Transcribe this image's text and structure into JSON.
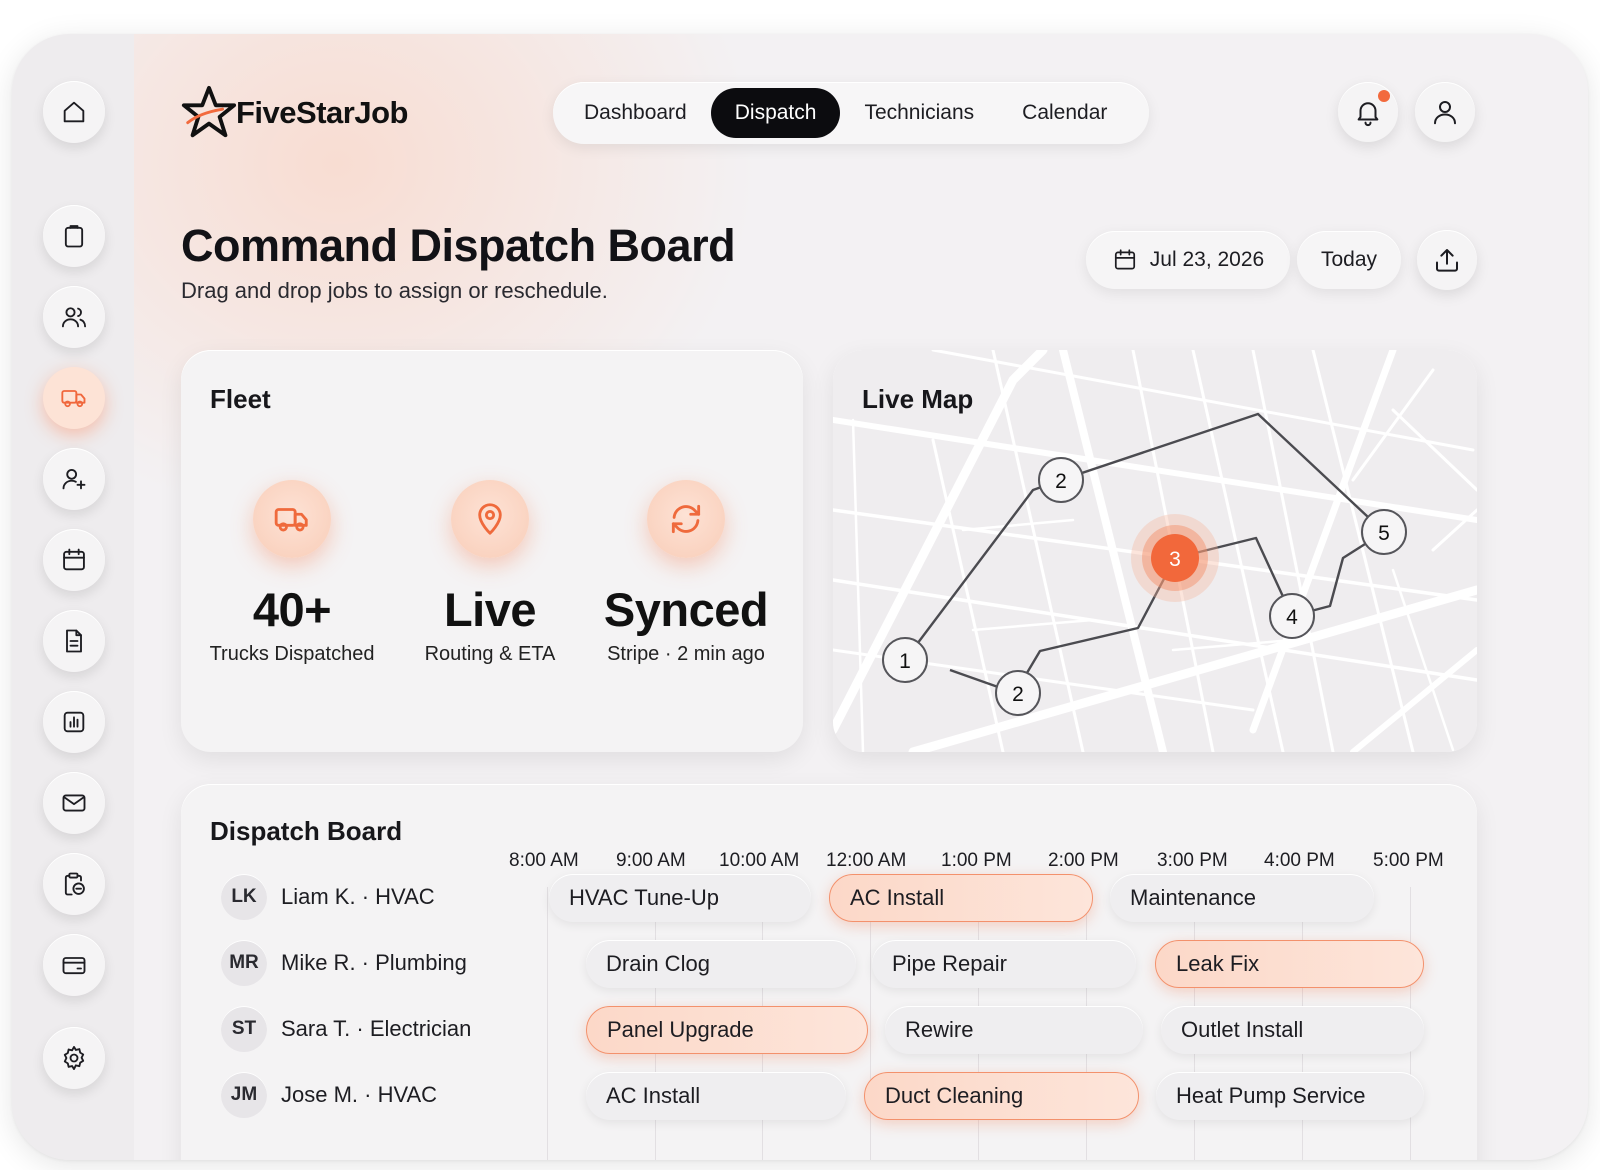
{
  "app": {
    "name": "FiveStarJob",
    "accent_color": "#f26a3d"
  },
  "sidebar": {
    "items": [
      {
        "name": "home",
        "icon": "home-icon"
      },
      {
        "name": "jobs",
        "icon": "clipboard-icon"
      },
      {
        "name": "customers",
        "icon": "users-icon"
      },
      {
        "name": "dispatch",
        "icon": "truck-icon",
        "active": true
      },
      {
        "name": "add-user",
        "icon": "user-plus-icon"
      },
      {
        "name": "calendar",
        "icon": "calendar-icon"
      },
      {
        "name": "documents",
        "icon": "document-icon"
      },
      {
        "name": "reports",
        "icon": "bar-chart-icon"
      },
      {
        "name": "messages",
        "icon": "mail-icon"
      },
      {
        "name": "tasks",
        "icon": "clipboard-clock-icon"
      },
      {
        "name": "payments",
        "icon": "credit-card-icon"
      },
      {
        "name": "settings",
        "icon": "gear-icon"
      }
    ]
  },
  "nav": {
    "tabs": [
      "Dashboard",
      "Dispatch",
      "Technicians",
      "Calendar"
    ],
    "active": "Dispatch"
  },
  "header": {
    "icons": [
      "bell-icon",
      "user-icon"
    ],
    "has_notification": true
  },
  "page": {
    "title": "Command Dispatch Board",
    "subtitle": "Drag and drop jobs to assign or reschedule.",
    "date": "Jul 23, 2026",
    "today_label": "Today"
  },
  "fleet": {
    "title": "Fleet",
    "stats": [
      {
        "value": "40+",
        "label": "Trucks Dispatched",
        "icon": "truck-icon"
      },
      {
        "value": "Live",
        "label": "Routing & ETA",
        "icon": "map-pin-icon"
      },
      {
        "value": "Synced",
        "label": "Stripe · 2 min ago",
        "icon": "refresh-icon"
      }
    ]
  },
  "map": {
    "title": "Live Map",
    "stops": [
      "1",
      "2",
      "2",
      "3",
      "4",
      "5"
    ],
    "highlighted_stop": "3"
  },
  "board": {
    "title": "Dispatch Board",
    "times": [
      "8:00 AM",
      "9:00 AM",
      "10:00 AM",
      "12:00 AM",
      "1:00 PM",
      "2:00 PM",
      "3:00 PM",
      "4:00 PM",
      "5:00 PM"
    ],
    "technicians": [
      {
        "initials": "LK",
        "name": "Liam K. · HVAC",
        "jobs": [
          {
            "label": "HVAC Tune-Up",
            "hot": false
          },
          {
            "label": "AC Install",
            "hot": true
          },
          {
            "label": "Maintenance",
            "hot": false
          }
        ]
      },
      {
        "initials": "MR",
        "name": "Mike R. · Plumbing",
        "jobs": [
          {
            "label": "Drain Clog",
            "hot": false
          },
          {
            "label": "Pipe Repair",
            "hot": false
          },
          {
            "label": "Leak Fix",
            "hot": true
          }
        ]
      },
      {
        "initials": "ST",
        "name": "Sara T. · Electrician",
        "jobs": [
          {
            "label": "Panel Upgrade",
            "hot": true
          },
          {
            "label": "Rewire",
            "hot": false
          },
          {
            "label": "Outlet Install",
            "hot": false
          }
        ]
      },
      {
        "initials": "JM",
        "name": "Jose M. · HVAC",
        "jobs": [
          {
            "label": "AC Install",
            "hot": false
          },
          {
            "label": "Duct Cleaning",
            "hot": true
          },
          {
            "label": "Heat Pump Service",
            "hot": false
          }
        ]
      }
    ]
  }
}
